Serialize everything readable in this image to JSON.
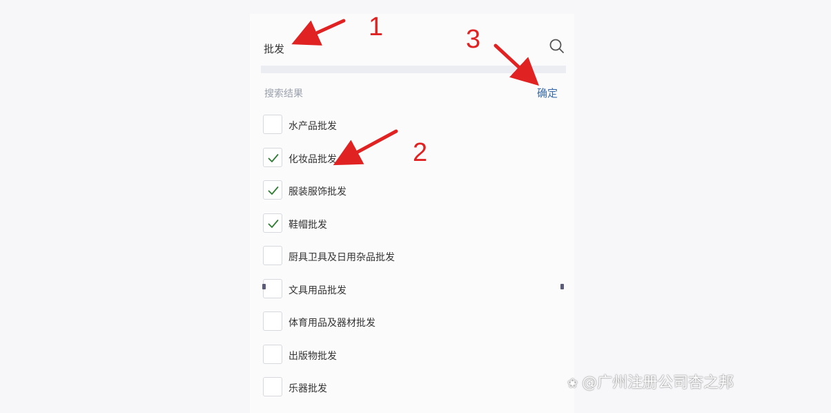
{
  "search": {
    "query": "批发"
  },
  "results": {
    "label": "搜索结果",
    "confirm_label": "确定"
  },
  "items": [
    {
      "label": "水产品批发",
      "checked": false
    },
    {
      "label": "化妆品批发",
      "checked": true
    },
    {
      "label": "服装服饰批发",
      "checked": true
    },
    {
      "label": "鞋帽批发",
      "checked": true
    },
    {
      "label": "厨具卫具及日用杂品批发",
      "checked": false
    },
    {
      "label": "文具用品批发",
      "checked": false
    },
    {
      "label": "体育用品及器材批发",
      "checked": false
    },
    {
      "label": "出版物批发",
      "checked": false
    },
    {
      "label": "乐器批发",
      "checked": false
    }
  ],
  "annotations": {
    "n1": "1",
    "n2": "2",
    "n3": "3"
  },
  "watermark": {
    "text": "@广州注册公司杏之邦"
  },
  "colors": {
    "accent": "#3a6ba8",
    "check": "#2e7d32",
    "annotation": "#e12222"
  }
}
